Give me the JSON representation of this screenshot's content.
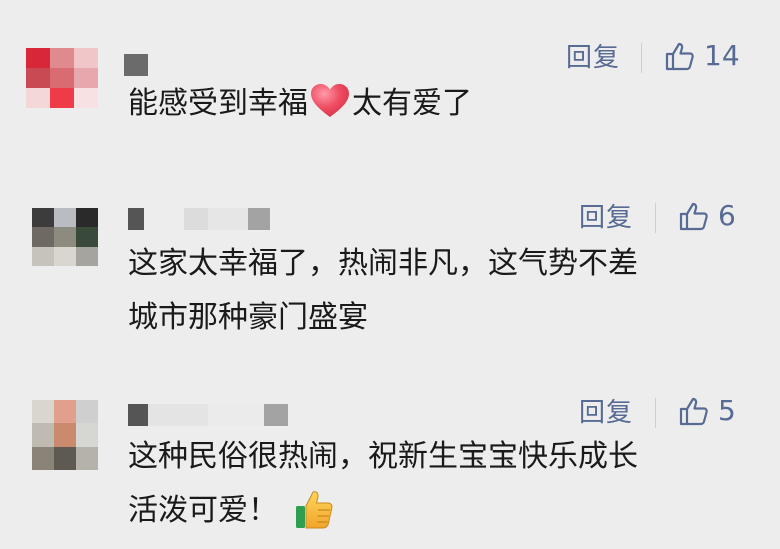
{
  "comments": [
    {
      "reply_label": "回复",
      "like_count": "14",
      "text": "能感受到幸福",
      "text_after_emoji": "太有爱了",
      "emoji": "heart-emoji"
    },
    {
      "reply_label": "回复",
      "like_count": "6",
      "text_line1": "这家太幸福了，热闹非凡，这气势不差",
      "text_line2": "城市那种豪门盛宴"
    },
    {
      "reply_label": "回复",
      "like_count": "5",
      "text_line1": "这种民俗很热闹，祝新生宝宝快乐成长",
      "text_line2": "活泼可爱！",
      "emoji": "thumbs-up-emoji"
    }
  ],
  "colors": {
    "background": "#ededed",
    "link": "#576b95",
    "text": "#1a1a1a",
    "heart": "#e8455a",
    "thumb": "#f5b942"
  }
}
